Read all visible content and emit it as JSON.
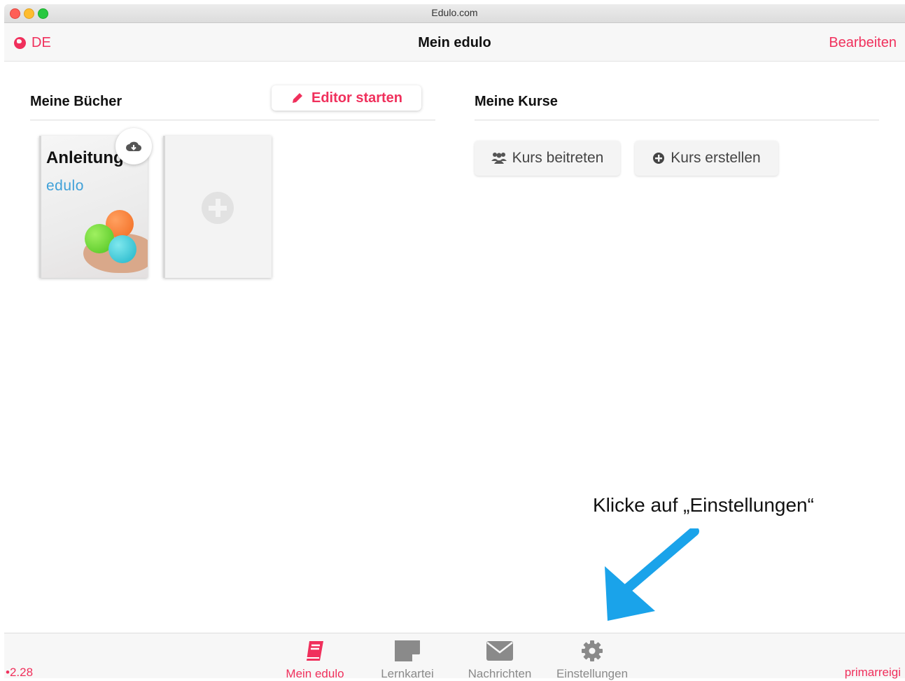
{
  "window": {
    "title": "Edulo.com"
  },
  "navbar": {
    "language": "DE",
    "title": "Mein edulo",
    "edit_label": "Bearbeiten"
  },
  "books": {
    "heading": "Meine Bücher",
    "editor_button": "Editor starten",
    "items": [
      {
        "cover_title": "Anleitung",
        "cover_logo": "edulo"
      }
    ]
  },
  "courses": {
    "heading": "Meine Kurse",
    "join_button": "Kurs beitreten",
    "create_button": "Kurs erstellen"
  },
  "annotation": {
    "hint": "Klicke auf „Einstellungen“"
  },
  "tabbar": {
    "version": "•2.28",
    "user": "primarreigi",
    "tabs": [
      {
        "label": "Mein edulo",
        "icon": "book-icon",
        "active": true
      },
      {
        "label": "Lernkartei",
        "icon": "note-icon",
        "active": false
      },
      {
        "label": "Nachrichten",
        "icon": "envelope-icon",
        "active": false
      },
      {
        "label": "Einstellungen",
        "icon": "gear-icon",
        "active": false
      }
    ]
  },
  "colors": {
    "accent": "#f0305c",
    "annotation_arrow": "#1aa3ea"
  }
}
